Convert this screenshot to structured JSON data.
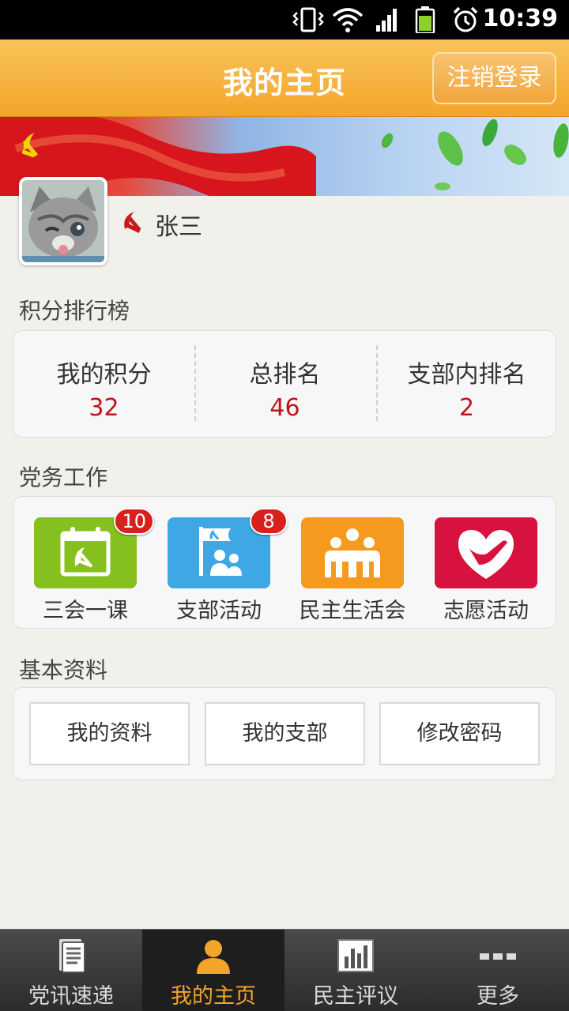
{
  "status_bar": {
    "time": "10:39"
  },
  "header": {
    "title": "我的主页",
    "logout_label": "注销登录"
  },
  "profile": {
    "name": "张三"
  },
  "ranking": {
    "section_title": "积分排行榜",
    "items": [
      {
        "label": "我的积分",
        "value": "32"
      },
      {
        "label": "总排名",
        "value": "46"
      },
      {
        "label": "支部内排名",
        "value": "2"
      }
    ]
  },
  "work": {
    "section_title": "党务工作",
    "items": [
      {
        "label": "三会一课",
        "badge": "10",
        "color": "#86c01e",
        "icon": "calendar-icon"
      },
      {
        "label": "支部活动",
        "badge": "8",
        "color": "#3fa8e4",
        "icon": "flag-people-icon"
      },
      {
        "label": "民主生活会",
        "badge": "",
        "color": "#f59a1f",
        "icon": "group-icon"
      },
      {
        "label": "志愿活动",
        "badge": "",
        "color": "#d8123e",
        "icon": "heart-hand-icon"
      }
    ]
  },
  "basic": {
    "section_title": "基本资料",
    "buttons": [
      {
        "label": "我的资料"
      },
      {
        "label": "我的支部"
      },
      {
        "label": "修改密码"
      }
    ]
  },
  "nav": {
    "items": [
      {
        "label": "党讯速递",
        "icon": "document-icon"
      },
      {
        "label": "我的主页",
        "icon": "person-icon",
        "active": true
      },
      {
        "label": "民主评议",
        "icon": "bar-chart-icon"
      },
      {
        "label": "更多",
        "icon": "more-icon"
      }
    ]
  },
  "colors": {
    "accent": "#f3a52a",
    "value_red": "#c0141b",
    "badge_red": "#d8211f"
  }
}
